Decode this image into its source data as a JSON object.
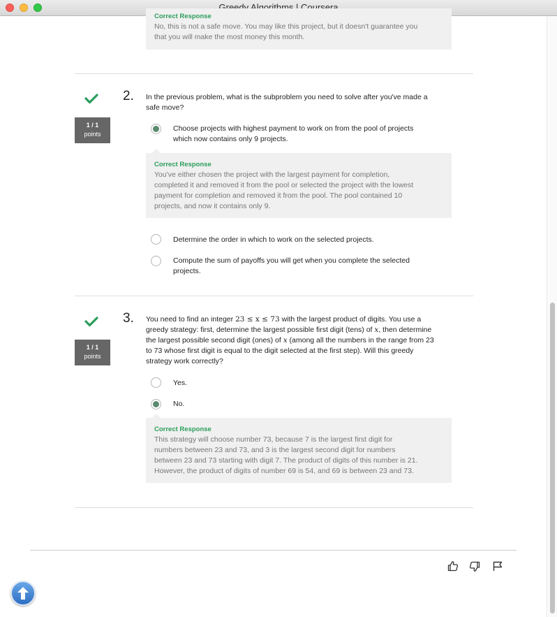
{
  "window": {
    "title": "Greedy Algorithms | Coursera"
  },
  "colors": {
    "correct_green": "#2a9d5a",
    "points_badge_bg": "#666666",
    "response_bg": "#f0f0f0"
  },
  "q1": {
    "response_label": "Correct Response",
    "response_lines": [
      "No, this is not a safe move. You may like this project, but it doesn't guarantee you",
      "that you will make the most money this month."
    ]
  },
  "q2": {
    "number": "2.",
    "check_icon": "checkmark-icon",
    "points": {
      "score": "1 / 1",
      "label": "points"
    },
    "question_lines": [
      "In the previous problem, what is the subproblem you need to solve after you've made a",
      "safe move?"
    ],
    "options": [
      {
        "lines": [
          "Choose projects with highest payment to work on from the pool of projects",
          "which now contains only 9 projects."
        ],
        "selected": true
      },
      {
        "lines": [
          "Determine the order in which to work on the selected projects."
        ],
        "selected": false
      },
      {
        "lines": [
          "Compute the sum of payoffs you will get when you complete the selected",
          "projects."
        ],
        "selected": false
      }
    ],
    "response_label": "Correct Response",
    "response_lines": [
      "You've either chosen the project with the largest payment for completion,",
      "completed it and removed it from the pool or selected the project with the lowest",
      "payment for completion and removed it from the pool. The pool contained 10",
      "projects, and now it contains only 9."
    ]
  },
  "q3": {
    "number": "3.",
    "check_icon": "checkmark-icon",
    "points": {
      "score": "1 / 1",
      "label": "points"
    },
    "question": {
      "l1_pre": "You need to find an integer ",
      "l1_math": "23 ≤ x ≤ 73",
      "l1_post": " with the largest product of digits. You use a",
      "l2_pre": "greedy strategy: first, determine the largest possible first digit (tens) of ",
      "l2_math": "x",
      "l2_post": ", then determine",
      "l3_pre": "the largest possible second digit (ones) of ",
      "l3_math": "x",
      "l3_post": " (among all the numbers in the range from 23",
      "l4": "to 73 whose first digit is equal to the digit selected at the first step). Will this greedy",
      "l5": "strategy work correctly?"
    },
    "options": [
      {
        "label": "Yes.",
        "selected": false
      },
      {
        "label": "No.",
        "selected": true
      }
    ],
    "response_label": "Correct Response",
    "response_lines": [
      "This strategy will choose number 73, because 7 is the largest first digit for",
      "numbers between 23 and 73, and 3 is the largest second digit for numbers",
      "between 23 and 73 starting with digit 7. The product of digits of this number is 21.",
      "However, the product of digits of number 69 is 54, and 69 is between 23 and 73."
    ]
  },
  "footer": {
    "icons": [
      "thumbs-up-icon",
      "thumbs-down-icon",
      "flag-icon"
    ]
  },
  "scroll_top": {
    "icon": "arrow-up-icon"
  }
}
